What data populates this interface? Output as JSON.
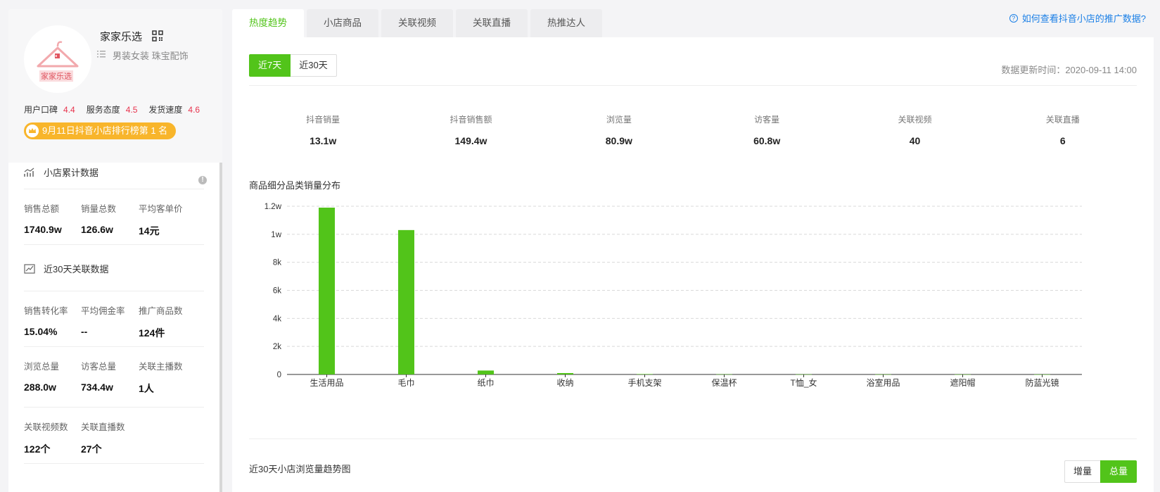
{
  "shop": {
    "name": "家家乐选",
    "categories": "男装女装 珠宝配饰",
    "logo_text": "家家乐选",
    "ratings": [
      {
        "label": "用户口碑",
        "value": "4.4"
      },
      {
        "label": "服务态度",
        "value": "4.5"
      },
      {
        "label": "发货速度",
        "value": "4.6"
      }
    ],
    "rank_badge": "9月11日抖音小店排行榜第 1 名"
  },
  "cumulative": {
    "title": "小店累计数据",
    "stats": [
      {
        "label": "销售总额",
        "value": "1740.9w"
      },
      {
        "label": "销量总数",
        "value": "126.6w"
      },
      {
        "label": "平均客单价",
        "value": "14元"
      }
    ]
  },
  "recent30": {
    "title": "近30天关联数据",
    "stats": [
      {
        "label": "销售转化率",
        "value": "15.04%"
      },
      {
        "label": "平均佣金率",
        "value": "--"
      },
      {
        "label": "推广商品数",
        "value": "124件"
      },
      {
        "label": "浏览总量",
        "value": "288.0w"
      },
      {
        "label": "访客总量",
        "value": "734.4w"
      },
      {
        "label": "关联主播数",
        "value": "1人"
      },
      {
        "label": "关联视频数",
        "value": "122个"
      },
      {
        "label": "关联直播数",
        "value": "27个"
      }
    ]
  },
  "tabs": [
    "热度趋势",
    "小店商品",
    "关联视频",
    "关联直播",
    "热推达人"
  ],
  "help_link": "如何查看抖音小店的推广数据?",
  "range": {
    "on": "近7天",
    "off": "近30天"
  },
  "update_time": "数据更新时间：2020-09-11 14:00",
  "metrics": [
    {
      "label": "抖音销量",
      "value": "13.1w"
    },
    {
      "label": "抖音销售额",
      "value": "149.4w"
    },
    {
      "label": "浏览量",
      "value": "80.9w"
    },
    {
      "label": "访客量",
      "value": "60.8w"
    },
    {
      "label": "关联视频",
      "value": "40"
    },
    {
      "label": "关联直播",
      "value": "6"
    }
  ],
  "chart_title": "商品细分品类销量分布",
  "trend_title": "近30天小店浏览量趋势图",
  "toggle": {
    "a": "增量",
    "b": "总量"
  },
  "colors": {
    "accent": "#52c41a",
    "rating": "#e8344e",
    "badge": "#f8b52b",
    "link": "#1a7fe6"
  },
  "chart_data": {
    "type": "bar",
    "categories": [
      "生活用品",
      "毛巾",
      "纸巾",
      "收纳",
      "手机支架",
      "保温杯",
      "T恤_女",
      "浴室用品",
      "遮阳帽",
      "防蓝光镜"
    ],
    "values": [
      11900,
      10300,
      280,
      100,
      30,
      15,
      10,
      8,
      5,
      3
    ],
    "ylim": [
      0,
      12000
    ],
    "yticks": [
      0,
      2000,
      4000,
      6000,
      8000,
      10000,
      12000
    ],
    "ytick_labels": [
      "0",
      "2k",
      "4k",
      "6k",
      "8k",
      "1w",
      "1.2w"
    ],
    "grid": true,
    "color": "#52c41a"
  }
}
